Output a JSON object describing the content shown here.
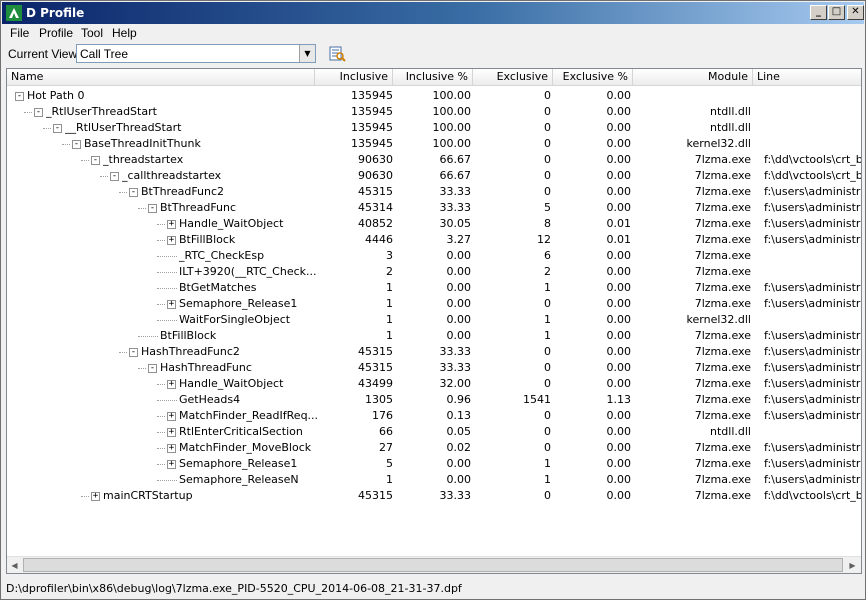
{
  "window": {
    "title": "D Profile",
    "min_glyph": "_",
    "max_glyph": "□",
    "close_glyph": "✕"
  },
  "menu": [
    "File",
    "Profile",
    "Tool",
    "Help"
  ],
  "toolbar": {
    "view_label": "Current View",
    "view_value": "Call Tree"
  },
  "columns": [
    "Name",
    "Inclusive",
    "Inclusive %",
    "Exclusive",
    "Exclusive %",
    "Module",
    "Line"
  ],
  "rows": [
    {
      "name": "Hot Path 0",
      "depth": 0,
      "exp": "-",
      "inc": "135945",
      "incp": "100.00",
      "exc": "0",
      "excp": "0.00",
      "mod": "",
      "line": ""
    },
    {
      "name": "_RtlUserThreadStart",
      "depth": 1,
      "exp": "-",
      "inc": "135945",
      "incp": "100.00",
      "exc": "0",
      "excp": "0.00",
      "mod": "ntdll.dll",
      "line": ""
    },
    {
      "name": "__RtlUserThreadStart",
      "depth": 2,
      "exp": "-",
      "inc": "135945",
      "incp": "100.00",
      "exc": "0",
      "excp": "0.00",
      "mod": "ntdll.dll",
      "line": ""
    },
    {
      "name": "BaseThreadInitThunk",
      "depth": 3,
      "exp": "-",
      "inc": "135945",
      "incp": "100.00",
      "exc": "0",
      "excp": "0.00",
      "mod": "kernel32.dll",
      "line": ""
    },
    {
      "name": "_threadstartex",
      "depth": 4,
      "exp": "-",
      "inc": "90630",
      "incp": "66.67",
      "exc": "0",
      "excp": "0.00",
      "mod": "7lzma.exe",
      "line": "f:\\dd\\vctools\\crt_bld"
    },
    {
      "name": "_callthreadstartex",
      "depth": 5,
      "exp": "-",
      "inc": "90630",
      "incp": "66.67",
      "exc": "0",
      "excp": "0.00",
      "mod": "7lzma.exe",
      "line": "f:\\dd\\vctools\\crt_bld"
    },
    {
      "name": "BtThreadFunc2",
      "depth": 6,
      "exp": "-",
      "inc": "45315",
      "incp": "33.33",
      "exc": "0",
      "excp": "0.00",
      "mod": "7lzma.exe",
      "line": "f:\\users\\administrato"
    },
    {
      "name": "BtThreadFunc",
      "depth": 7,
      "exp": "-",
      "inc": "45314",
      "incp": "33.33",
      "exc": "5",
      "excp": "0.00",
      "mod": "7lzma.exe",
      "line": "f:\\users\\administrato"
    },
    {
      "name": "Handle_WaitObject",
      "depth": 8,
      "exp": "+",
      "inc": "40852",
      "incp": "30.05",
      "exc": "8",
      "excp": "0.01",
      "mod": "7lzma.exe",
      "line": "f:\\users\\administrato"
    },
    {
      "name": "BtFillBlock",
      "depth": 8,
      "exp": "+",
      "inc": "4446",
      "incp": "3.27",
      "exc": "12",
      "excp": "0.01",
      "mod": "7lzma.exe",
      "line": "f:\\users\\administrato"
    },
    {
      "name": "_RTC_CheckEsp",
      "depth": 8,
      "exp": "",
      "inc": "3",
      "incp": "0.00",
      "exc": "6",
      "excp": "0.00",
      "mod": "7lzma.exe",
      "line": ""
    },
    {
      "name": "ILT+3920(__RTC_Check...",
      "depth": 8,
      "exp": "",
      "inc": "2",
      "incp": "0.00",
      "exc": "2",
      "excp": "0.00",
      "mod": "7lzma.exe",
      "line": ""
    },
    {
      "name": "BtGetMatches",
      "depth": 8,
      "exp": "",
      "inc": "1",
      "incp": "0.00",
      "exc": "1",
      "excp": "0.00",
      "mod": "7lzma.exe",
      "line": "f:\\users\\administrato"
    },
    {
      "name": "Semaphore_Release1",
      "depth": 8,
      "exp": "+",
      "inc": "1",
      "incp": "0.00",
      "exc": "0",
      "excp": "0.00",
      "mod": "7lzma.exe",
      "line": "f:\\users\\administrato"
    },
    {
      "name": "WaitForSingleObject",
      "depth": 8,
      "exp": "",
      "inc": "1",
      "incp": "0.00",
      "exc": "1",
      "excp": "0.00",
      "mod": "kernel32.dll",
      "line": ""
    },
    {
      "name": "BtFillBlock",
      "depth": 7,
      "exp": "",
      "inc": "1",
      "incp": "0.00",
      "exc": "1",
      "excp": "0.00",
      "mod": "7lzma.exe",
      "line": "f:\\users\\administrato"
    },
    {
      "name": "HashThreadFunc2",
      "depth": 6,
      "exp": "-",
      "inc": "45315",
      "incp": "33.33",
      "exc": "0",
      "excp": "0.00",
      "mod": "7lzma.exe",
      "line": "f:\\users\\administrato"
    },
    {
      "name": "HashThreadFunc",
      "depth": 7,
      "exp": "-",
      "inc": "45315",
      "incp": "33.33",
      "exc": "0",
      "excp": "0.00",
      "mod": "7lzma.exe",
      "line": "f:\\users\\administrato"
    },
    {
      "name": "Handle_WaitObject",
      "depth": 8,
      "exp": "+",
      "inc": "43499",
      "incp": "32.00",
      "exc": "0",
      "excp": "0.00",
      "mod": "7lzma.exe",
      "line": "f:\\users\\administrato"
    },
    {
      "name": "GetHeads4",
      "depth": 8,
      "exp": "",
      "inc": "1305",
      "incp": "0.96",
      "exc": "1541",
      "excp": "1.13",
      "mod": "7lzma.exe",
      "line": "f:\\users\\administrato"
    },
    {
      "name": "MatchFinder_ReadIfReq...",
      "depth": 8,
      "exp": "+",
      "inc": "176",
      "incp": "0.13",
      "exc": "0",
      "excp": "0.00",
      "mod": "7lzma.exe",
      "line": "f:\\users\\administrato"
    },
    {
      "name": "RtlEnterCriticalSection",
      "depth": 8,
      "exp": "+",
      "inc": "66",
      "incp": "0.05",
      "exc": "0",
      "excp": "0.00",
      "mod": "ntdll.dll",
      "line": ""
    },
    {
      "name": "MatchFinder_MoveBlock",
      "depth": 8,
      "exp": "+",
      "inc": "27",
      "incp": "0.02",
      "exc": "0",
      "excp": "0.00",
      "mod": "7lzma.exe",
      "line": "f:\\users\\administrato"
    },
    {
      "name": "Semaphore_Release1",
      "depth": 8,
      "exp": "+",
      "inc": "5",
      "incp": "0.00",
      "exc": "1",
      "excp": "0.00",
      "mod": "7lzma.exe",
      "line": "f:\\users\\administrato"
    },
    {
      "name": "Semaphore_ReleaseN",
      "depth": 8,
      "exp": "",
      "inc": "1",
      "incp": "0.00",
      "exc": "1",
      "excp": "0.00",
      "mod": "7lzma.exe",
      "line": "f:\\users\\administrato"
    },
    {
      "name": "mainCRTStartup",
      "depth": 4,
      "exp": "+",
      "inc": "45315",
      "incp": "33.33",
      "exc": "0",
      "excp": "0.00",
      "mod": "7lzma.exe",
      "line": "f:\\dd\\vctools\\crt_bld"
    }
  ],
  "status": "D:\\dprofiler\\bin\\x86\\debug\\log\\7lzma.exe_PID-5520_CPU_2014-06-08_21-31-37.dpf",
  "colors": {
    "titlebar_start": "#0a246a",
    "titlebar_end": "#a6caf0",
    "icon_green": "#1e8e3e"
  }
}
